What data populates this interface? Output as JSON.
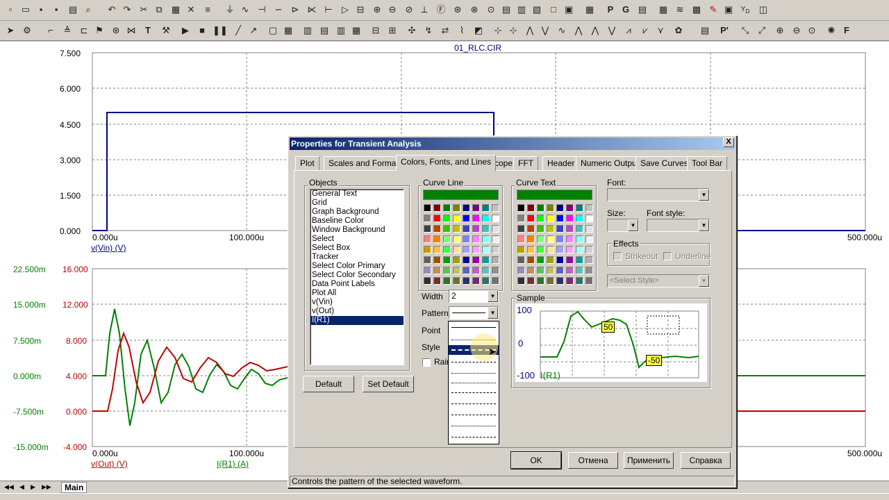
{
  "plot": {
    "title": "01_RLC.CIR",
    "top": {
      "y_ticks": [
        "7.500",
        "6.000",
        "4.500",
        "3.000",
        "1.500",
        "0.000"
      ],
      "x_ticks": [
        "0.000u",
        "100.000u",
        "500.000u"
      ],
      "trace_label": "v(Vin) (V)"
    },
    "bottom": {
      "left_ticks": [
        "22.500m",
        "15.000m",
        "7.500m",
        "0.000m",
        "-7.500m",
        "-15.000m"
      ],
      "right_ticks": [
        "16.000",
        "12.000",
        "8.000",
        "4.000",
        "0.000",
        "-4.000"
      ],
      "x_ticks": [
        "0.000u",
        "100.000u",
        "500.000u"
      ],
      "trace_label_1": "v(Out) (V)",
      "trace_label_2": "I(R1) (A)"
    },
    "colors": {
      "vin": "#000080",
      "vout": "#c00000",
      "ir1": "#008000",
      "grid": "#808080"
    }
  },
  "sheet_tab": "Main",
  "dialog": {
    "title": "Properties for Transient Analysis",
    "close": "X",
    "tabs": [
      "Plot",
      "Scales and Formats",
      "Colors, Fonts, and Lines",
      "Scope",
      "FFT",
      "Header",
      "Numeric Output",
      "Save Curves",
      "Tool Bar"
    ],
    "active_tab": "Colors, Fonts, and Lines",
    "objects_label": "Objects",
    "objects": [
      "General Text",
      "Grid",
      "Graph Background",
      "Baseline Color",
      "Window Background",
      "Select",
      "Select Box",
      "Tracker",
      "Select Color Primary",
      "Select Color Secondary",
      "Data Point Labels",
      "Plot All",
      "v(Vin)",
      "v(Out)",
      "I(R1)"
    ],
    "selected_object": "I(R1)",
    "curve_line_label": "Curve Line",
    "curve_text_label": "Curve Text",
    "current_color": "#008000",
    "width_label": "Width",
    "width_value": "2",
    "pattern_label": "Pattern",
    "point_label": "Point",
    "style_label": "Style",
    "rainbow_label": "Rain",
    "font_label": "Font:",
    "size_label": "Size:",
    "font_style_label": "Font style:",
    "effects_label": "Effects",
    "strikeout_label": "Strikeout",
    "underline_label": "Underline",
    "select_style_placeholder": "<Select Style>",
    "sample_label": "Sample",
    "sample": {
      "y_top": "100",
      "y_mid": "0",
      "y_bottom": "-100",
      "trace": "I(R1)",
      "tag_pos": "50",
      "tag_neg": "-50"
    },
    "default_button": "Default",
    "set_default_button": "Set Default",
    "ok_button": "OK",
    "cancel_button": "Отмена",
    "apply_button": "Применить",
    "help_button": "Справка",
    "status": "Controls the pattern of the selected waveform."
  }
}
